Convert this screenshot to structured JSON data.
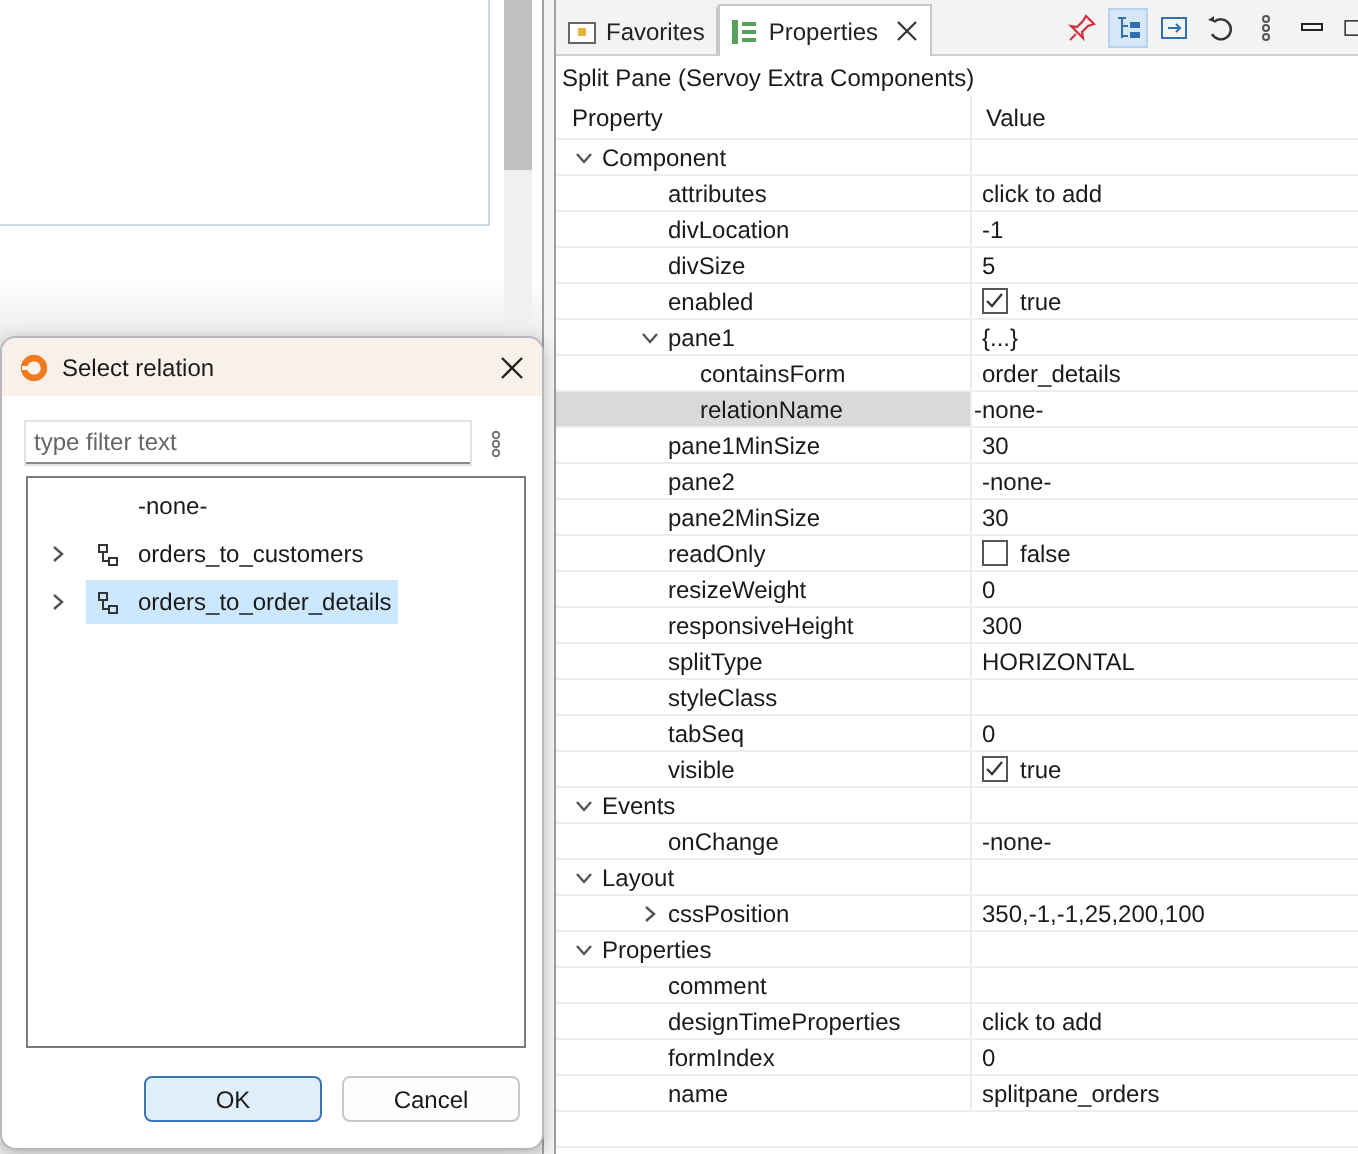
{
  "properties_view": {
    "tabs": [
      {
        "label": "Favorites",
        "kind": "favorites",
        "selected": false
      },
      {
        "label": "Properties",
        "kind": "properties",
        "selected": true
      }
    ],
    "toolbar": [
      {
        "kind": "pin",
        "selected": false
      },
      {
        "kind": "tree",
        "selected": true
      },
      {
        "kind": "link",
        "selected": false
      },
      {
        "kind": "undo",
        "selected": false
      },
      {
        "kind": "more",
        "selected": false
      },
      {
        "kind": "minimize",
        "selected": false
      },
      {
        "kind": "maximize",
        "selected": false
      }
    ],
    "subject": "Split Pane (Servoy Extra Components)",
    "columns": [
      "Property",
      "Value"
    ],
    "rows": [
      {
        "name": "Component",
        "kind": "category",
        "expanded": true,
        "children": [
          {
            "name": "attributes",
            "kind": "text",
            "value": "click to add"
          },
          {
            "name": "divLocation",
            "kind": "text",
            "value": "-1"
          },
          {
            "name": "divSize",
            "kind": "text",
            "value": "5"
          },
          {
            "name": "enabled",
            "kind": "checkbox",
            "checked": true,
            "value": "true"
          },
          {
            "name": "pane1",
            "kind": "text",
            "value": "{...}",
            "expanded": true,
            "children": [
              {
                "name": "containsForm",
                "kind": "text",
                "value": "order_details"
              },
              {
                "name": "relationName",
                "kind": "text",
                "value": "-none-",
                "selected": true
              }
            ]
          },
          {
            "name": "pane1MinSize",
            "kind": "text",
            "value": "30"
          },
          {
            "name": "pane2",
            "kind": "text",
            "value": "-none-"
          },
          {
            "name": "pane2MinSize",
            "kind": "text",
            "value": "30"
          },
          {
            "name": "readOnly",
            "kind": "checkbox",
            "checked": false,
            "value": "false"
          },
          {
            "name": "resizeWeight",
            "kind": "text",
            "value": "0"
          },
          {
            "name": "responsiveHeight",
            "kind": "text",
            "value": "300"
          },
          {
            "name": "splitType",
            "kind": "text",
            "value": "HORIZONTAL"
          },
          {
            "name": "styleClass",
            "kind": "text"
          },
          {
            "name": "tabSeq",
            "kind": "text",
            "value": "0"
          },
          {
            "name": "visible",
            "kind": "checkbox",
            "checked": true,
            "value": "true"
          }
        ]
      },
      {
        "name": "Events",
        "kind": "category",
        "expanded": true,
        "children": [
          {
            "name": "onChange",
            "kind": "text",
            "value": "-none-"
          }
        ]
      },
      {
        "name": "Layout",
        "kind": "category",
        "expanded": true,
        "children": [
          {
            "name": "cssPosition",
            "kind": "text",
            "value": "350,-1,-1,25,200,100",
            "expanded": false
          }
        ]
      },
      {
        "name": "Properties",
        "kind": "category",
        "expanded": true,
        "children": [
          {
            "name": "comment",
            "kind": "text"
          },
          {
            "name": "designTimeProperties",
            "kind": "text",
            "value": "click to add"
          },
          {
            "name": "formIndex",
            "kind": "text",
            "value": "0"
          },
          {
            "name": "name",
            "kind": "text",
            "value": "splitpane_orders"
          }
        ]
      }
    ]
  },
  "dialog": {
    "title": "Select relation",
    "filter": {
      "placeholder": "type filter text"
    },
    "items": [
      {
        "label": "-none-",
        "kind": "none",
        "selected": false
      },
      {
        "label": "orders_to_customers",
        "kind": "relation",
        "expanded": false,
        "selected": false
      },
      {
        "label": "orders_to_order_details",
        "kind": "relation",
        "expanded": false,
        "selected": true
      }
    ],
    "buttons": [
      {
        "label": "OK",
        "kind": "default"
      },
      {
        "label": "Cancel",
        "kind": "normal"
      }
    ]
  }
}
